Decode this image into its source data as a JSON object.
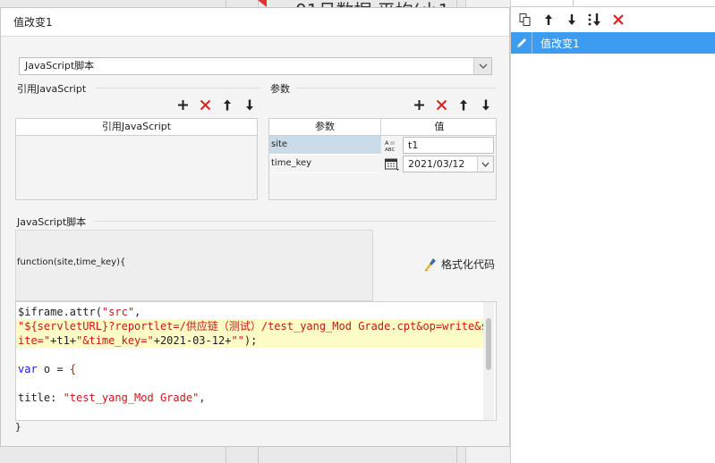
{
  "background": {
    "title_fragment": "01月数据 平均(小1"
  },
  "dialog": {
    "title": "值改变1",
    "script_type": "JavaScript脚本",
    "ref_section_label": "引用JavaScript",
    "ref_table_header": "引用JavaScript",
    "params_section_label": "参数",
    "params_table": {
      "col_param": "参数",
      "col_value": "值",
      "rows": [
        {
          "name": "site",
          "type_icon": "ABC",
          "value": "t1"
        },
        {
          "name": "time_key",
          "type_icon": "calendar",
          "value": "2021/03/12"
        }
      ]
    },
    "script_section_label": "JavaScript脚本",
    "function_signature": "function(site,time_key){",
    "format_button": "格式化代码",
    "code_lines": [
      [
        {
          "t": "n",
          "v": "$iframe.attr("
        },
        {
          "t": "s",
          "v": "\"src\""
        },
        {
          "t": "n",
          "v": ","
        }
      ],
      [
        {
          "t": "s",
          "v": "\"${servletURL}?reportlet=/供应链（测试）/test_yang_Mod Grade.cpt&op=write&s"
        }
      ],
      [
        {
          "t": "s",
          "v": "ite=\""
        },
        {
          "t": "n",
          "v": "+t1+"
        },
        {
          "t": "s",
          "v": "\"&time_key=\""
        },
        {
          "t": "n",
          "v": "+2021-03-12+"
        },
        {
          "t": "s",
          "v": "\"\""
        },
        {
          "t": "n",
          "v": ");"
        }
      ],
      [
        {
          "t": "n",
          "v": ""
        }
      ],
      [
        {
          "t": "k",
          "v": "var"
        },
        {
          "t": "n",
          "v": " o = "
        },
        {
          "t": "s",
          "v": "{"
        }
      ],
      [
        {
          "t": "n",
          "v": ""
        }
      ],
      [
        {
          "t": "n",
          "v": "title: "
        },
        {
          "t": "s",
          "v": "\"test_yang_Mod Grade\""
        },
        {
          "t": "n",
          "v": ","
        }
      ],
      [
        {
          "t": "n",
          "v": ""
        }
      ]
    ],
    "highlighted_lines": [
      1,
      2
    ],
    "closing_brace": "}"
  },
  "right_panel": {
    "events": [
      {
        "label": "值改变1",
        "selected": true
      }
    ]
  },
  "colors": {
    "selection_blue": "#3d9bf0",
    "delete_red": "#e02020",
    "code_string": "#c41a16",
    "code_keyword": "#1a1ae0",
    "highlight": "#fdfbc6"
  }
}
